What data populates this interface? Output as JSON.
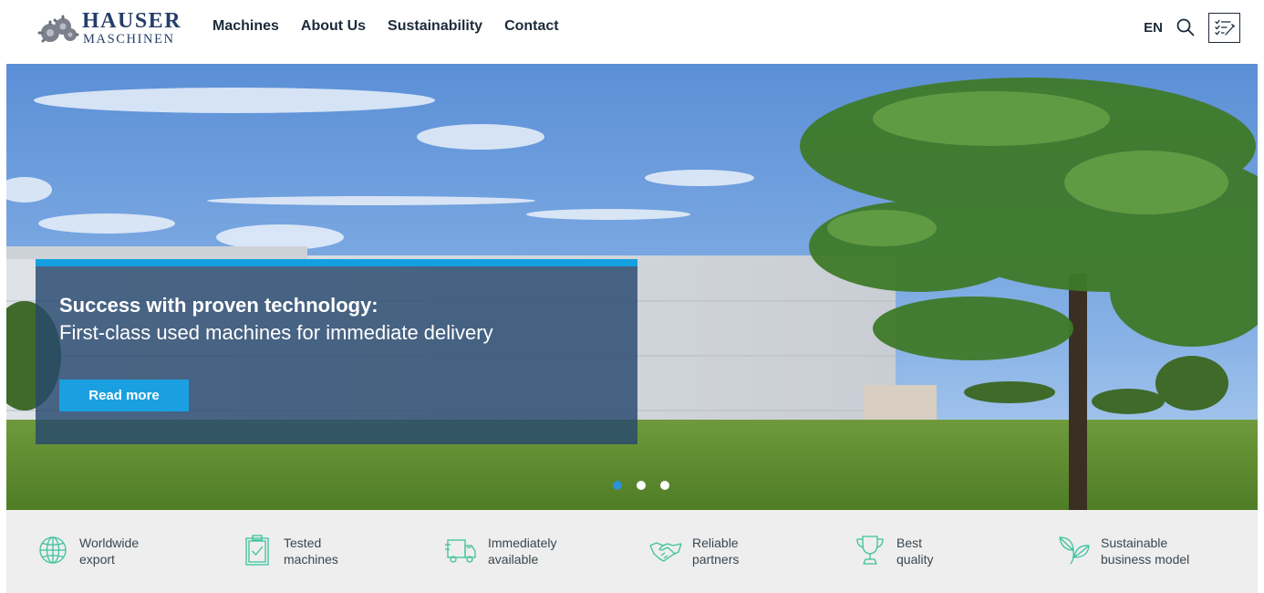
{
  "brand": {
    "name_top": "HAUSER",
    "name_bottom": "MASCHINEN",
    "color": "#253e68"
  },
  "nav": {
    "items": [
      {
        "label": "Machines"
      },
      {
        "label": "About Us"
      },
      {
        "label": "Sustainability"
      },
      {
        "label": "Contact"
      }
    ]
  },
  "header": {
    "language": "EN",
    "search_icon": "search-icon",
    "notes_icon": "checklist-icon"
  },
  "hero": {
    "title": "Success with proven technology:",
    "subtitle": "First-class used machines for immediate delivery",
    "button_label": "Read more",
    "accent": "#14a0e0",
    "slides": 3,
    "active_slide": 1
  },
  "features": [
    {
      "icon": "globe-icon",
      "line1": "Worldwide",
      "line2": "export"
    },
    {
      "icon": "clipboard-check-icon",
      "line1": "Tested",
      "line2": "machines"
    },
    {
      "icon": "truck-icon",
      "line1": "Immediately",
      "line2": "available"
    },
    {
      "icon": "handshake-icon",
      "line1": "Reliable",
      "line2": "partners"
    },
    {
      "icon": "trophy-icon",
      "line1": "Best",
      "line2": "quality"
    },
    {
      "icon": "leaf-icon",
      "line1": "Sustainable",
      "line2": "business model"
    }
  ],
  "colors": {
    "feature_icon": "#3cc29a",
    "feature_band": "#eeeeee"
  }
}
